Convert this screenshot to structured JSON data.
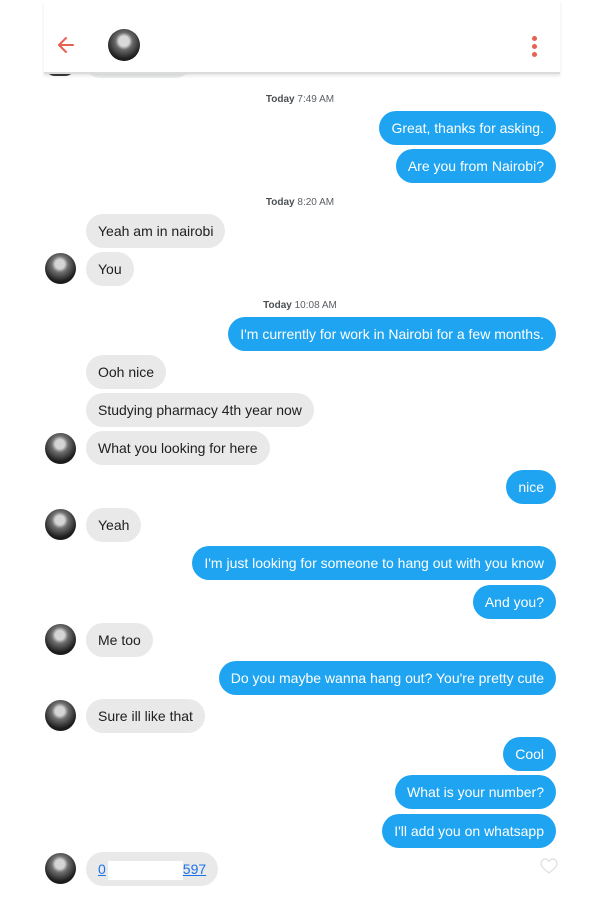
{
  "header": {
    "back_icon": "arrow-left-icon",
    "more_icon": "vertical-dots-icon"
  },
  "timestamps": [
    {
      "day": "Today",
      "time": "7:49 AM"
    },
    {
      "day": "Today",
      "time": "8:20 AM"
    },
    {
      "day": "Today",
      "time": "10:08 AM"
    }
  ],
  "messages": [
    {
      "side": "out",
      "text": "Great, thanks for asking."
    },
    {
      "side": "out",
      "text": "Are you from Nairobi?"
    },
    {
      "side": "in",
      "text": "Yeah am in nairobi"
    },
    {
      "side": "in",
      "text": "You"
    },
    {
      "side": "out",
      "text": "I'm currently for work in Nairobi for a few months."
    },
    {
      "side": "in",
      "text": "Ooh nice"
    },
    {
      "side": "in",
      "text": "Studying pharmacy 4th year now"
    },
    {
      "side": "in",
      "text": "What you looking for here"
    },
    {
      "side": "out",
      "text": "nice"
    },
    {
      "side": "in",
      "text": "Yeah"
    },
    {
      "side": "out",
      "text": "I'm just looking for someone to hang out with you know"
    },
    {
      "side": "out",
      "text": "And you?"
    },
    {
      "side": "in",
      "text": "Me too"
    },
    {
      "side": "out",
      "text": "Do you maybe wanna hang out? You're pretty cute"
    },
    {
      "side": "in",
      "text": "Sure ill like that"
    },
    {
      "side": "out",
      "text": "Cool"
    },
    {
      "side": "out",
      "text": "What is your number?"
    },
    {
      "side": "out",
      "text": "I'll add you on whatsapp"
    },
    {
      "side": "in",
      "text_prefix": "0",
      "text_suffix": "597"
    }
  ],
  "colors": {
    "outgoing": "#1ea4f0",
    "incoming": "#e9e9ea",
    "accent": "#e8604f",
    "link": "#1a73e8"
  }
}
